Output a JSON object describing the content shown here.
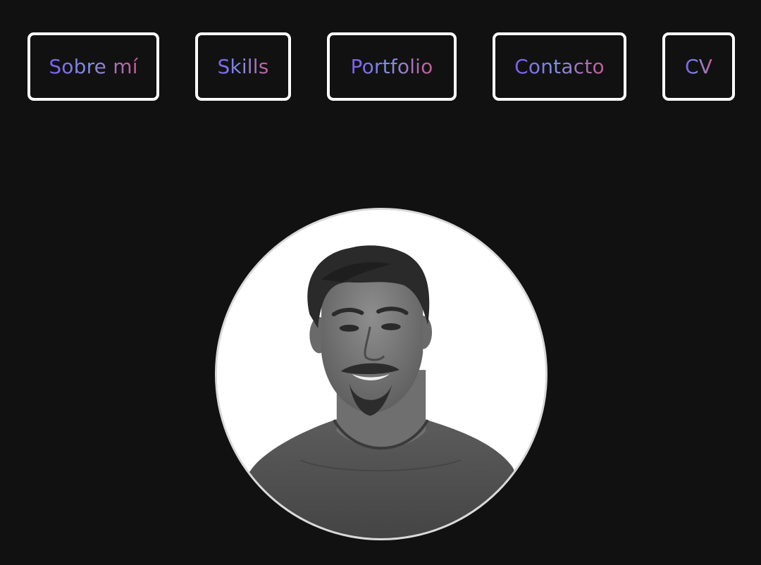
{
  "nav": {
    "items": [
      {
        "label": "Sobre mí"
      },
      {
        "label": "Skills"
      },
      {
        "label": "Portfolio"
      },
      {
        "label": "Contacto"
      },
      {
        "label": "CV"
      }
    ]
  },
  "theme": {
    "background": "#111111",
    "button_border": "#ffffff",
    "gradient_start": "#7d5cf0",
    "gradient_mid": "#7f8fe0",
    "gradient_end": "#c65a94"
  }
}
